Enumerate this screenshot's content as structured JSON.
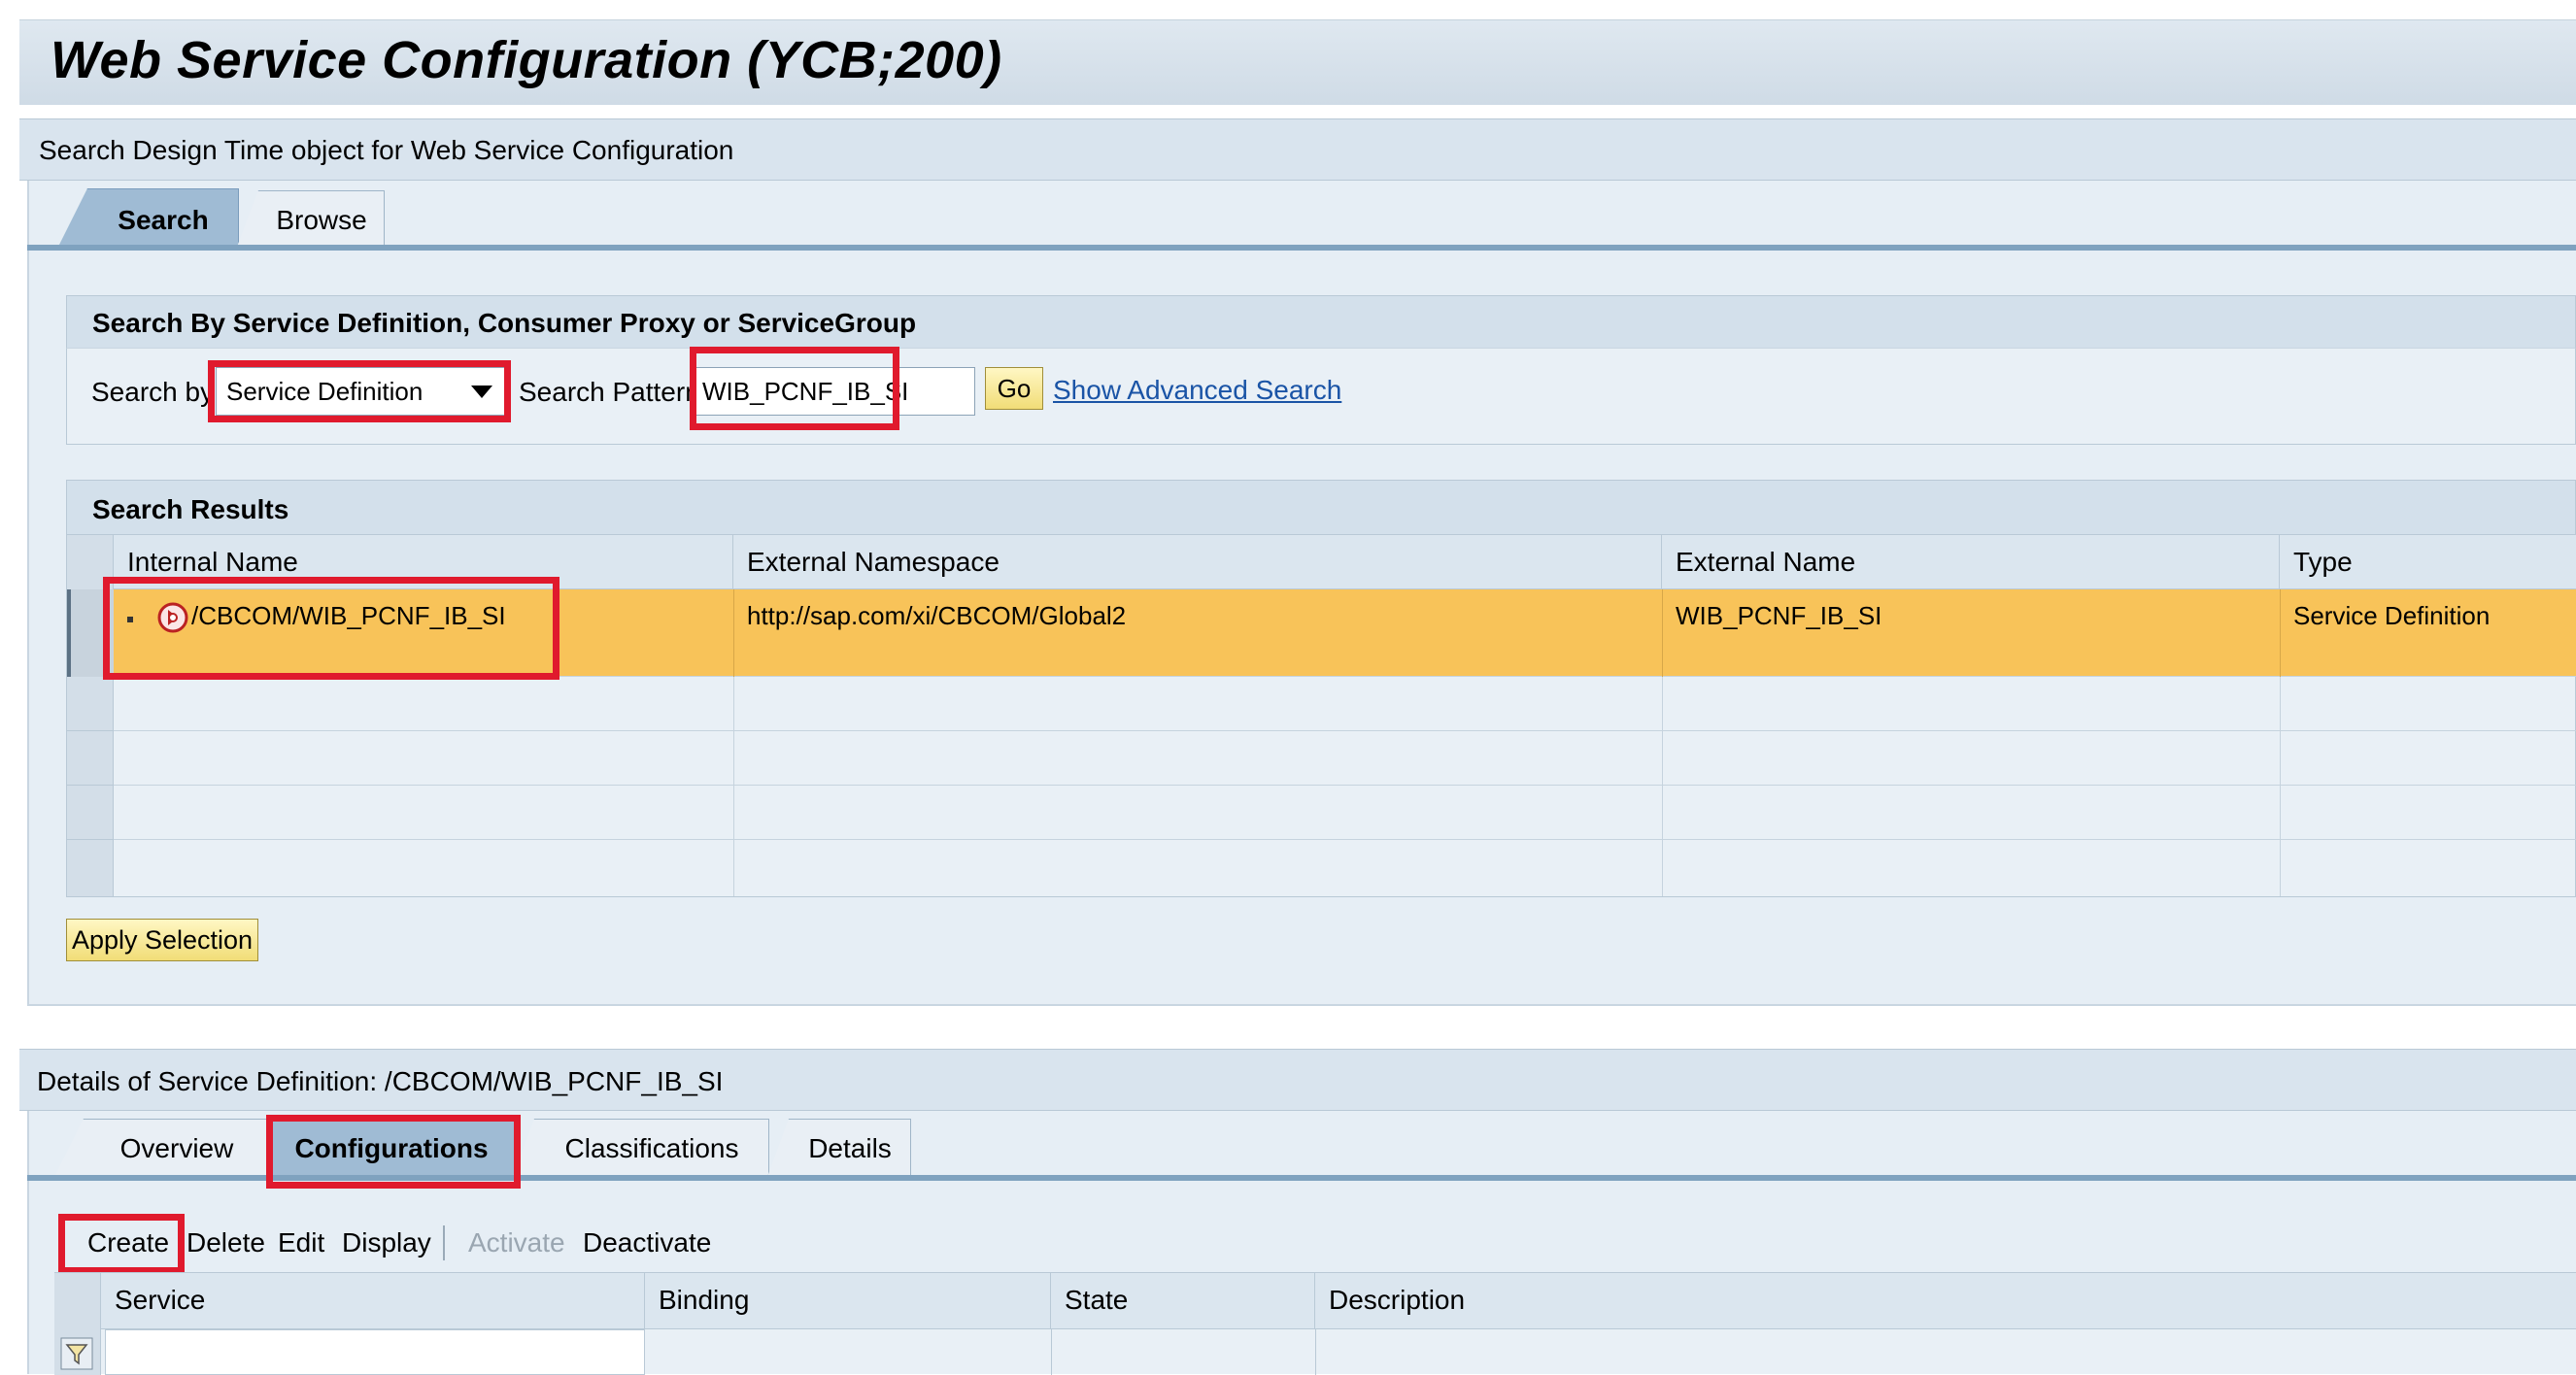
{
  "page": {
    "title": "Web Service Configuration (YCB;200)"
  },
  "search_panel": {
    "title": "Search Design Time object for Web Service Configuration",
    "tabs": [
      "Search",
      "Browse"
    ],
    "criteria": {
      "title": "Search By Service Definition, Consumer Proxy or ServiceGroup",
      "search_by_label": "Search by:",
      "search_by_value": "Service Definition",
      "search_pattern_label": "Search Pattern:",
      "search_pattern_value": "WIB_PCNF_IB_SI",
      "go_label": "Go",
      "advanced_link": "Show Advanced Search"
    },
    "results": {
      "title": "Search Results",
      "columns": [
        "Internal Name",
        "External Namespace",
        "External Name",
        "Type"
      ],
      "rows": [
        {
          "internal_name": "/CBCOM/WIB_PCNF_IB_SI",
          "external_namespace": "http://sap.com/xi/CBCOM/Global2",
          "external_name": "WIB_PCNF_IB_SI",
          "type": "Service Definition",
          "icon": "service-definition-icon",
          "selected": true
        }
      ],
      "apply_label": "Apply Selection"
    }
  },
  "details_panel": {
    "title": "Details of Service Definition: /CBCOM/WIB_PCNF_IB_SI",
    "tabs": [
      "Overview",
      "Configurations",
      "Classifications",
      "Details"
    ],
    "active_tab": "Configurations",
    "toolbar": {
      "create": "Create",
      "delete": "Delete",
      "edit": "Edit",
      "display": "Display",
      "activate": "Activate",
      "deactivate": "Deactivate"
    },
    "config_columns": [
      "Service",
      "Binding",
      "State",
      "Description"
    ]
  },
  "colors": {
    "highlight": "#e01a2d",
    "selected_row": "#f8c359",
    "link": "#1a54a6",
    "active_tab": "#9fbbd4"
  }
}
